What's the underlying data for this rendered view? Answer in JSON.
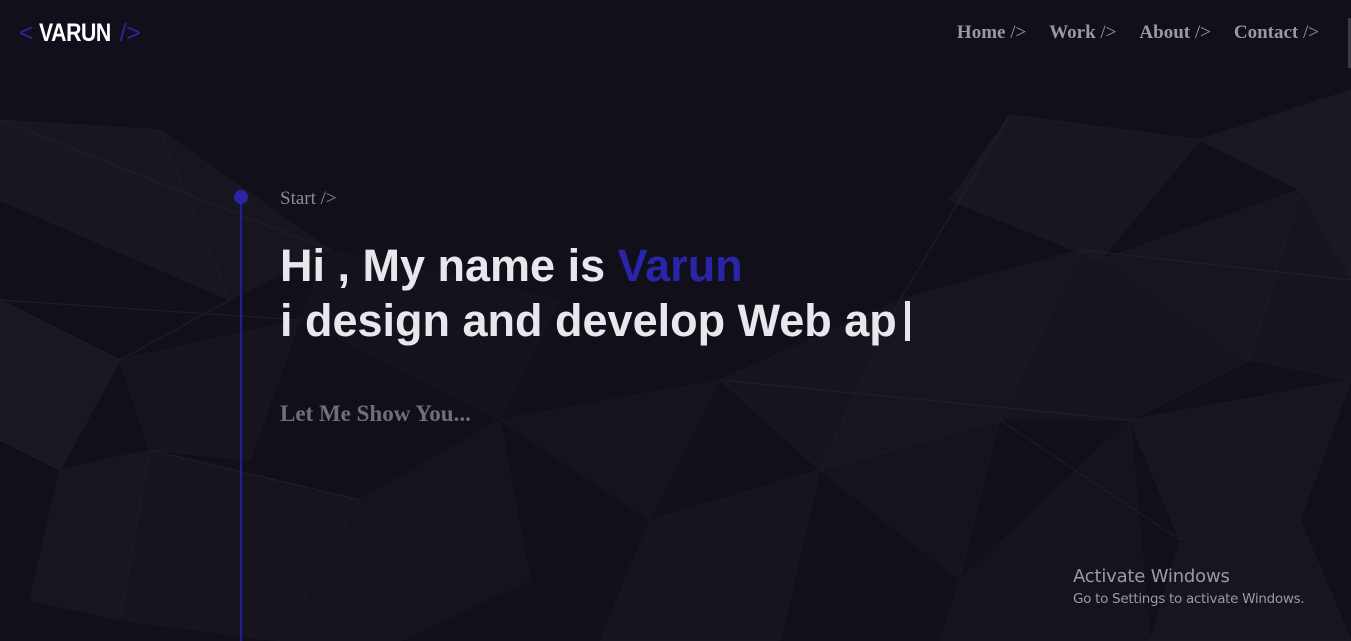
{
  "logo": {
    "open_bracket": "<",
    "name": "VARUN",
    "close_bracket": "/>"
  },
  "nav": {
    "items": [
      {
        "label": "Home",
        "suffix": " />"
      },
      {
        "label": "Work",
        "suffix": " />"
      },
      {
        "label": "About",
        "suffix": " />"
      },
      {
        "label": "Contact",
        "suffix": " />"
      }
    ]
  },
  "hero": {
    "start_label": "Start />",
    "line1_prefix": "Hi , My name is ",
    "line1_name": "Varun",
    "line2": "i design and develop Web ap",
    "subtext": "Let Me Show You..."
  },
  "watermark": {
    "title": "Activate Windows",
    "subtitle": "Go to Settings to activate Windows."
  },
  "colors": {
    "background": "#11101a",
    "accent": "#2a25a8",
    "text": "#e8e8ec",
    "muted": "#8d8d8d"
  }
}
